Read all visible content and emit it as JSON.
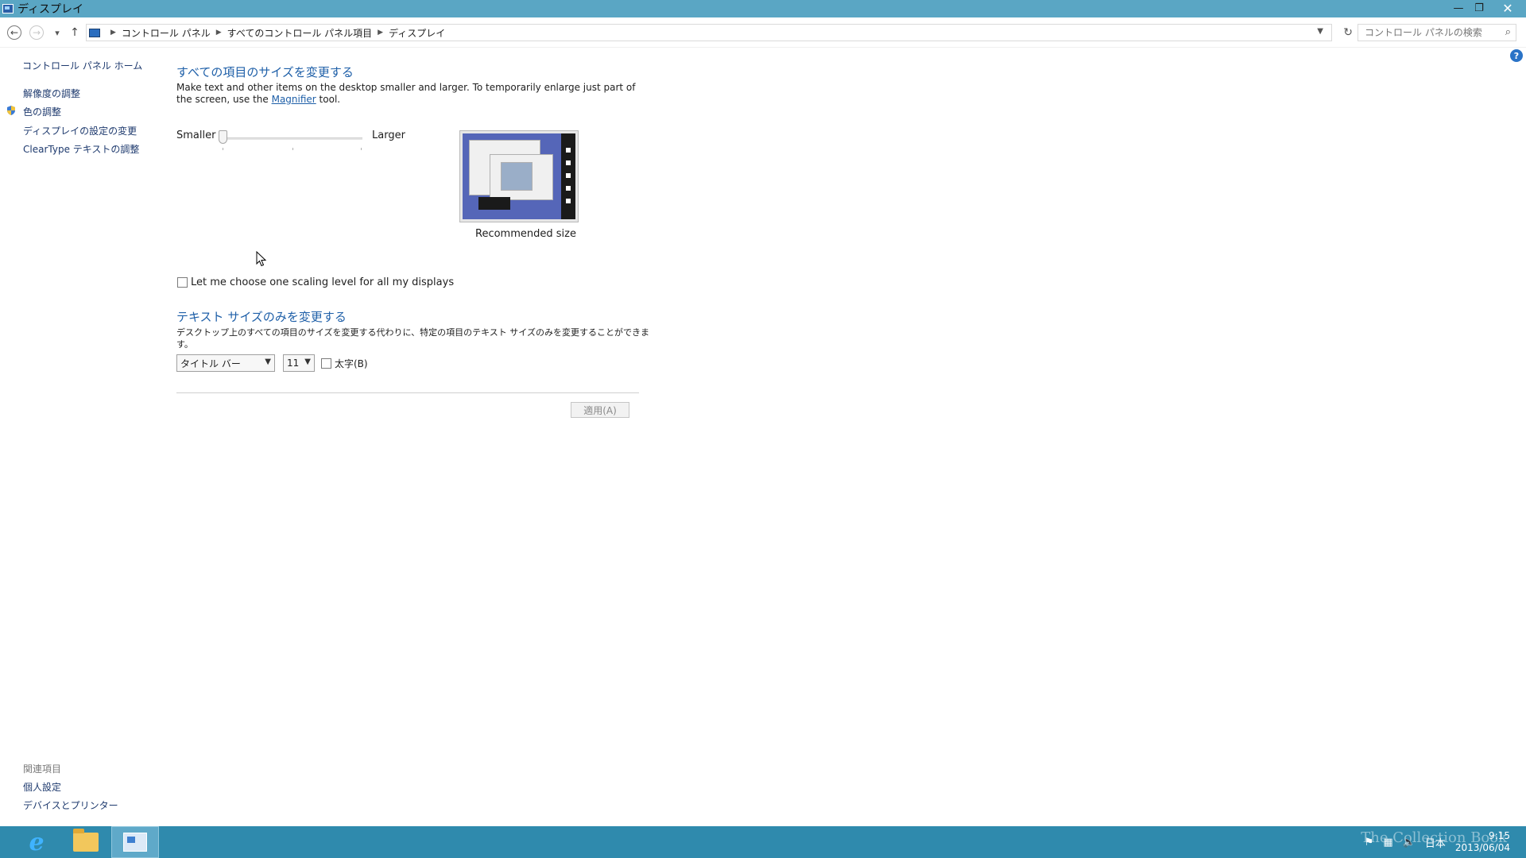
{
  "window": {
    "title": "ディスプレイ",
    "minimize": "—",
    "restore": "❐",
    "close": "✕"
  },
  "navigation": {
    "back": "←",
    "forward": "→",
    "recent": "▾",
    "up": "↑",
    "breadcrumbs": [
      "コントロール パネル",
      "すべてのコントロール パネル項目",
      "ディスプレイ"
    ],
    "search_placeholder": "コントロール パネルの検索"
  },
  "sidebar": {
    "home": "コントロール パネル ホーム",
    "links": [
      "解像度の調整",
      "色の調整",
      "ディスプレイの設定の変更",
      "ClearType テキストの調整"
    ],
    "related_heading": "関連項目",
    "related_links": [
      "個人設定",
      "デバイスとプリンター"
    ]
  },
  "main": {
    "section1_title": "すべての項目のサイズを変更する",
    "desc_part1": "Make text and other items on the desktop smaller and larger. To temporarily enlarge just part of the screen, use the ",
    "desc_link": "Magnifier",
    "desc_part2": " tool.",
    "slider_smaller": "Smaller",
    "slider_larger": "Larger",
    "slider_value": 0,
    "preview_caption": "Recommended size",
    "scaling_checkbox": "Let me choose one scaling level for all my displays",
    "section2_title": "テキスト サイズのみを変更する",
    "section2_desc": "デスクトップ上のすべての項目のサイズを変更する代わりに、特定の項目のテキスト サイズのみを変更することができます。",
    "item_select": "タイトル バー",
    "size_select": "11",
    "bold_checkbox": "太字(B)",
    "apply_button": "適用(A)"
  },
  "taskbar": {
    "tray_language": "日本",
    "clock_time": "9:15",
    "clock_date": "2013/06/04",
    "watermark": "The Collection Book"
  },
  "colors": {
    "titlebar": "#5aa6c4",
    "taskbar": "#2f8aad",
    "link": "#1e5fa8"
  }
}
